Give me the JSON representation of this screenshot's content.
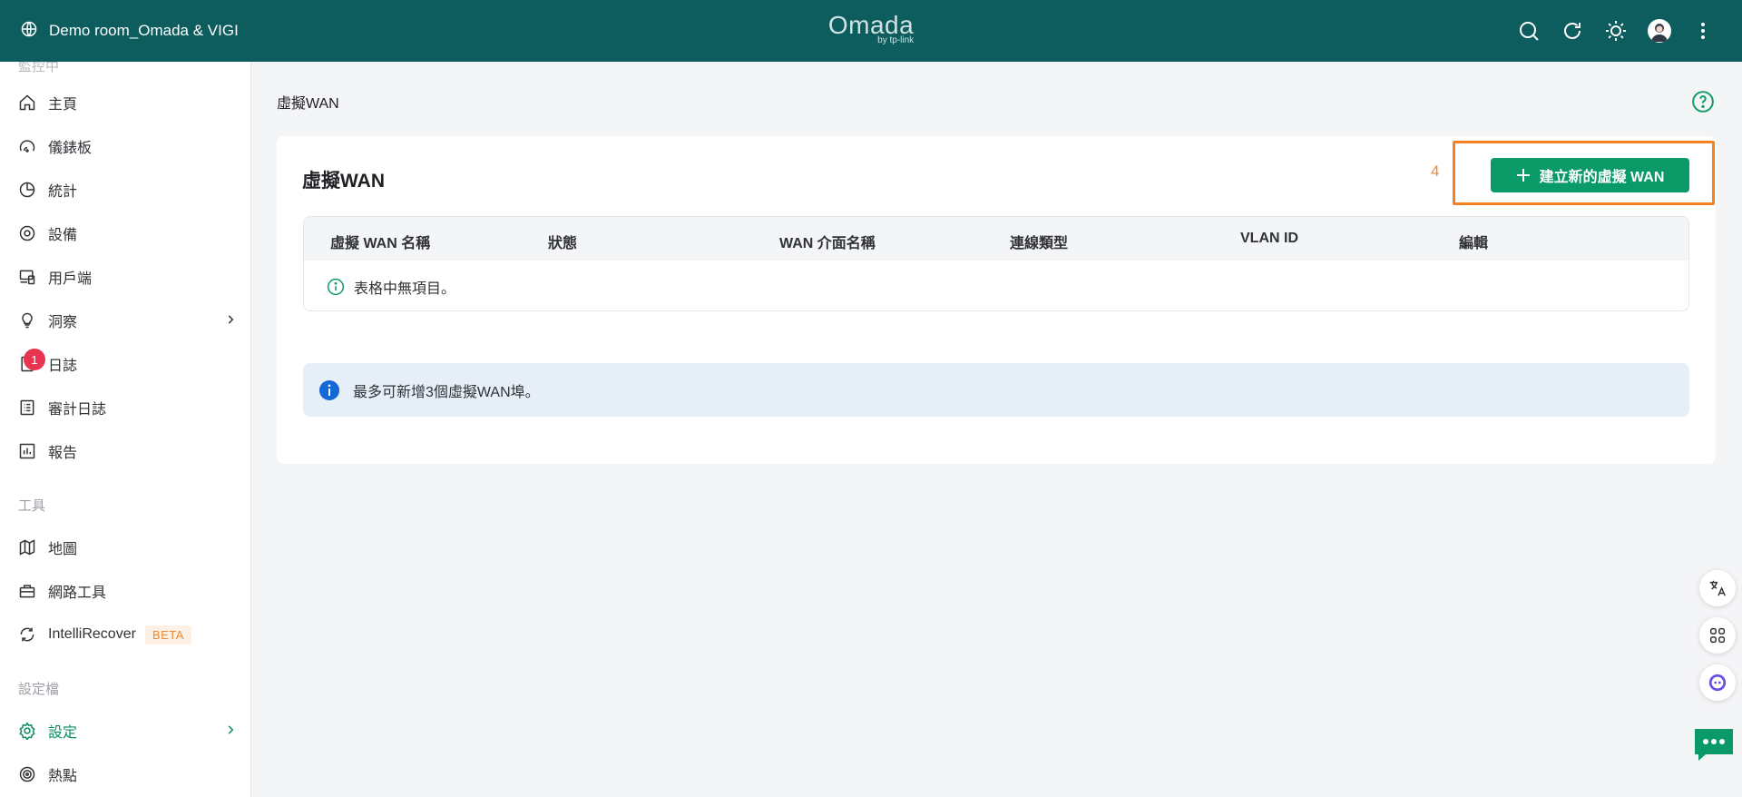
{
  "header": {
    "site_name": "Demo room_Omada & VIGI",
    "logo_word": "Omada",
    "logo_sub": "by tp-link",
    "actions": [
      "search-icon",
      "refresh-icon",
      "theme-sun-icon",
      "avatar",
      "more-vertical-icon"
    ]
  },
  "sidebar": {
    "partial_section": "監控中",
    "items": [
      {
        "label": "主頁",
        "icon": "home-icon"
      },
      {
        "label": "儀錶板",
        "icon": "dashboard-icon"
      },
      {
        "label": "統計",
        "icon": "pie-chart-icon"
      },
      {
        "label": "設備",
        "icon": "device-icon"
      },
      {
        "label": "用戶端",
        "icon": "client-icon"
      },
      {
        "label": "洞察",
        "icon": "bulb-icon"
      },
      {
        "label": "日誌",
        "icon": "log-icon",
        "badge": "1"
      },
      {
        "label": "審計日誌",
        "icon": "audit-log-icon"
      },
      {
        "label": "報告",
        "icon": "report-icon"
      }
    ],
    "tools_title": "工具",
    "tools": [
      {
        "label": "地圖",
        "icon": "map-icon"
      },
      {
        "label": "網路工具",
        "icon": "toolbox-icon"
      },
      {
        "label": "IntelliRecover",
        "icon": "recover-icon",
        "tag": "BETA"
      }
    ],
    "profile_title": "設定檔",
    "profile": [
      {
        "label": "設定",
        "icon": "gear-icon",
        "active": true
      },
      {
        "label": "熱點",
        "icon": "hotspot-icon"
      }
    ]
  },
  "main": {
    "page_title": "虛擬WAN",
    "card_title": "虛擬WAN",
    "step_number": "4",
    "add_button": "建立新的虛擬 WAN",
    "table": {
      "columns": [
        "虛擬 WAN 名稱",
        "狀態",
        "WAN 介面名稱",
        "連線類型",
        "VLAN ID",
        "編輯"
      ],
      "empty_text": "表格中無項目。"
    },
    "note": "最多可新增3個虛擬WAN埠。"
  },
  "colors": {
    "topbar": "#0d5c5e",
    "accent": "#0a9a68",
    "highlight": "#f58220",
    "badge": "#e8344e",
    "note_bg": "#e6eef8"
  }
}
